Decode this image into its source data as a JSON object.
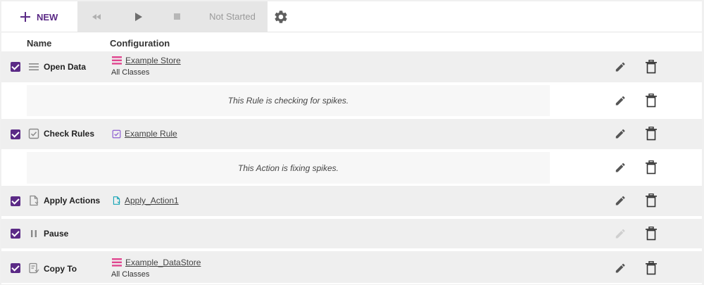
{
  "toolbar": {
    "new_label": "NEW",
    "status": "Not Started"
  },
  "header": {
    "name": "Name",
    "configuration": "Configuration"
  },
  "rows": [
    {
      "name": "Open Data",
      "config_link": "Example Store",
      "config_sub": "All Classes",
      "checked": true
    },
    {
      "note": "This Rule is checking for spikes."
    },
    {
      "name": "Check Rules",
      "config_link": "Example Rule",
      "checked": true
    },
    {
      "note": "This Action is fixing spikes."
    },
    {
      "name": "Apply Actions",
      "config_link": "Apply_Action1",
      "checked": true
    },
    {
      "name": "Pause",
      "checked": true,
      "edit_disabled": true
    },
    {
      "name": "Copy To",
      "config_link": "Example_DataStore",
      "config_sub": "All Classes",
      "checked": true
    }
  ],
  "colors": {
    "accent": "#5b2a86",
    "store_icon": "#e0468f",
    "rule_icon": "#8e5fd1",
    "action_icon": "#1aa6b7"
  }
}
